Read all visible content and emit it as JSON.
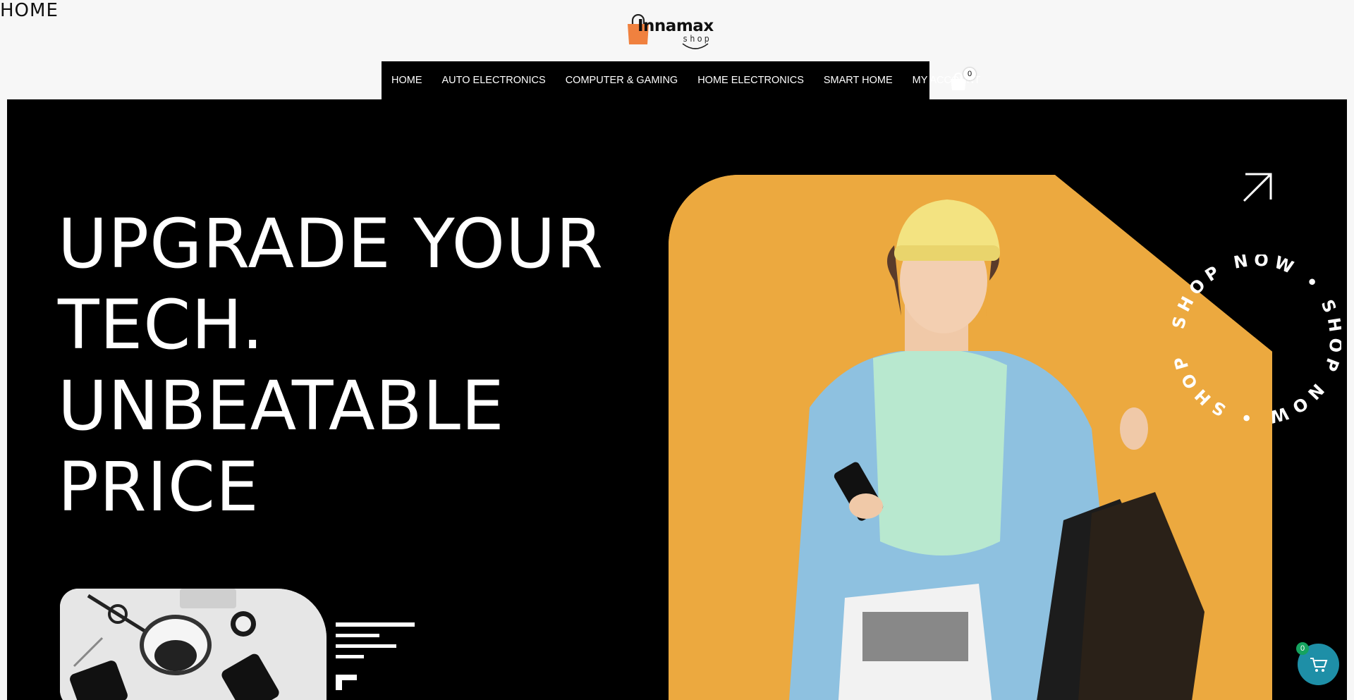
{
  "page": {
    "title": "HOME"
  },
  "logo": {
    "name": "Innamax",
    "sub": "shop",
    "icon": "shopping-bag-icon",
    "accent": "#f0813f"
  },
  "nav": {
    "items": [
      {
        "label": "HOME"
      },
      {
        "label": "AUTO ELECTRONICS"
      },
      {
        "label": "COMPUTER & GAMING"
      },
      {
        "label": "HOME ELECTRONICS"
      },
      {
        "label": "SMART HOME"
      },
      {
        "label": "MY ACCOUNT"
      }
    ],
    "cart_count": "0"
  },
  "hero": {
    "headline_lines": [
      "UPGRADE YOUR",
      "TECH.",
      "UNBEATABLE",
      "PRICE"
    ],
    "badge_text": "SHOP NOW • SHOP NOW • SHOP NOW •",
    "photo_background": "#eca93f",
    "arrow_icon": "arrow-up-right-icon"
  },
  "floating_cart": {
    "count": "0",
    "color": "#1e8fa7",
    "badge_color": "#15a35f"
  }
}
